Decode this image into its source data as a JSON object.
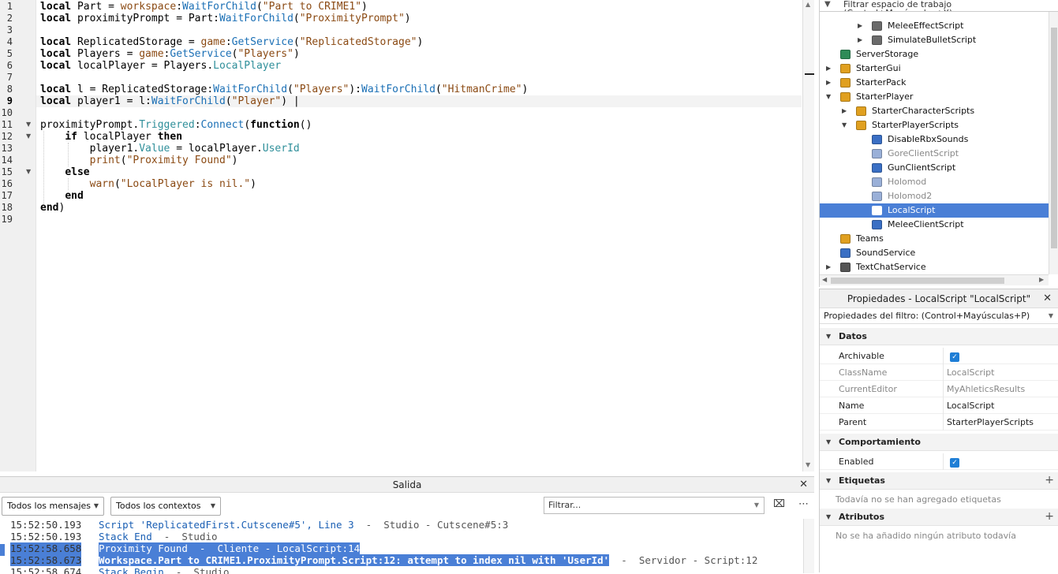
{
  "editor": {
    "line_numbers": [
      "1",
      "2",
      "3",
      "4",
      "5",
      "6",
      "7",
      "8",
      "9",
      "10",
      "11",
      "12",
      "13",
      "14",
      "15",
      "16",
      "17",
      "18",
      "19"
    ],
    "current_line": "9",
    "lines": [
      [
        {
          "c": "kw",
          "t": "local"
        },
        {
          "c": "",
          "t": " Part = "
        },
        {
          "c": "st",
          "t": "workspace"
        },
        {
          "c": "",
          "t": ":"
        },
        {
          "c": "fn",
          "t": "WaitForChild"
        },
        {
          "c": "",
          "t": "("
        },
        {
          "c": "st",
          "t": "\"Part to CRIME1\""
        },
        {
          "c": "",
          "t": ")"
        }
      ],
      [
        {
          "c": "kw",
          "t": "local"
        },
        {
          "c": "",
          "t": " proximityPrompt = Part:"
        },
        {
          "c": "fn",
          "t": "WaitForChild"
        },
        {
          "c": "",
          "t": "("
        },
        {
          "c": "st",
          "t": "\"ProximityPrompt\""
        },
        {
          "c": "",
          "t": ")"
        }
      ],
      [],
      [
        {
          "c": "kw",
          "t": "local"
        },
        {
          "c": "",
          "t": " ReplicatedStorage = "
        },
        {
          "c": "st",
          "t": "game"
        },
        {
          "c": "",
          "t": ":"
        },
        {
          "c": "fn",
          "t": "GetService"
        },
        {
          "c": "",
          "t": "("
        },
        {
          "c": "st",
          "t": "\"ReplicatedStorage\""
        },
        {
          "c": "",
          "t": ")"
        }
      ],
      [
        {
          "c": "kw",
          "t": "local"
        },
        {
          "c": "",
          "t": " Players = "
        },
        {
          "c": "st",
          "t": "game"
        },
        {
          "c": "",
          "t": ":"
        },
        {
          "c": "fn",
          "t": "GetService"
        },
        {
          "c": "",
          "t": "("
        },
        {
          "c": "st",
          "t": "\"Players\""
        },
        {
          "c": "",
          "t": ")"
        }
      ],
      [
        {
          "c": "kw",
          "t": "local"
        },
        {
          "c": "",
          "t": " localPlayer = Players."
        },
        {
          "c": "pr",
          "t": "LocalPlayer"
        }
      ],
      [],
      [
        {
          "c": "kw",
          "t": "local"
        },
        {
          "c": "",
          "t": " l = ReplicatedStorage:"
        },
        {
          "c": "fn",
          "t": "WaitForChild"
        },
        {
          "c": "",
          "t": "("
        },
        {
          "c": "st",
          "t": "\"Players\""
        },
        {
          "c": "",
          "t": "):"
        },
        {
          "c": "fn",
          "t": "WaitForChild"
        },
        {
          "c": "",
          "t": "("
        },
        {
          "c": "st",
          "t": "\"HitmanCrime\""
        },
        {
          "c": "",
          "t": ")"
        }
      ],
      [
        {
          "c": "kw",
          "t": "local"
        },
        {
          "c": "",
          "t": " player1 = l:"
        },
        {
          "c": "fn",
          "t": "WaitForChild"
        },
        {
          "c": "",
          "t": "("
        },
        {
          "c": "st",
          "t": "\"Player\""
        },
        {
          "c": "",
          "t": ") |"
        }
      ],
      [],
      [
        {
          "c": "",
          "t": "proximityPrompt."
        },
        {
          "c": "pr",
          "t": "Triggered"
        },
        {
          "c": "",
          "t": ":"
        },
        {
          "c": "fn",
          "t": "Connect"
        },
        {
          "c": "",
          "t": "("
        },
        {
          "c": "kw",
          "t": "function"
        },
        {
          "c": "",
          "t": "()"
        }
      ],
      [
        {
          "c": "",
          "t": "    "
        },
        {
          "c": "kw",
          "t": "if"
        },
        {
          "c": "",
          "t": " localPlayer "
        },
        {
          "c": "kw",
          "t": "then"
        }
      ],
      [
        {
          "c": "",
          "t": "        player1."
        },
        {
          "c": "pr",
          "t": "Value"
        },
        {
          "c": "",
          "t": " = localPlayer."
        },
        {
          "c": "pr",
          "t": "UserId"
        }
      ],
      [
        {
          "c": "",
          "t": "        "
        },
        {
          "c": "st",
          "t": "print"
        },
        {
          "c": "",
          "t": "("
        },
        {
          "c": "st",
          "t": "\"Proximity Found\""
        },
        {
          "c": "",
          "t": ")"
        }
      ],
      [
        {
          "c": "",
          "t": "    "
        },
        {
          "c": "kw",
          "t": "else"
        }
      ],
      [
        {
          "c": "",
          "t": "        "
        },
        {
          "c": "st",
          "t": "warn"
        },
        {
          "c": "",
          "t": "("
        },
        {
          "c": "st",
          "t": "\"LocalPlayer is nil.\""
        },
        {
          "c": "",
          "t": ")"
        }
      ],
      [
        {
          "c": "",
          "t": "    "
        },
        {
          "c": "kw",
          "t": "end"
        }
      ],
      [
        {
          "c": "kw",
          "t": "end"
        },
        {
          "c": "",
          "t": ")"
        }
      ],
      []
    ]
  },
  "explorer": {
    "filter_placeholder": "Filtrar espacio de trabajo (Control+Mayúsculas+X)",
    "items": [
      {
        "label": "MeleeEffectScript",
        "depth": 2,
        "twisty": "▶",
        "icon": "script-icon",
        "color": "#6b6b6b",
        "selected": false,
        "disabled": false
      },
      {
        "label": "SimulateBulletScript",
        "depth": 2,
        "twisty": "▶",
        "icon": "script-icon",
        "color": "#6b6b6b",
        "selected": false,
        "disabled": false
      },
      {
        "label": "ServerStorage",
        "depth": 0,
        "twisty": "",
        "icon": "server-storage-icon",
        "color": "#2e8b57",
        "selected": false,
        "disabled": false
      },
      {
        "label": "StarterGui",
        "depth": 0,
        "twisty": "▶",
        "icon": "folder-icon",
        "color": "#e0a020",
        "selected": false,
        "disabled": false
      },
      {
        "label": "StarterPack",
        "depth": 0,
        "twisty": "▶",
        "icon": "folder-icon",
        "color": "#e0a020",
        "selected": false,
        "disabled": false
      },
      {
        "label": "StarterPlayer",
        "depth": 0,
        "twisty": "▼",
        "icon": "folder-icon",
        "color": "#e0a020",
        "selected": false,
        "disabled": false
      },
      {
        "label": "StarterCharacterScripts",
        "depth": 1,
        "twisty": "▶",
        "icon": "folder-script-icon",
        "color": "#e0a020",
        "selected": false,
        "disabled": false
      },
      {
        "label": "StarterPlayerScripts",
        "depth": 1,
        "twisty": "▼",
        "icon": "folder-script-icon",
        "color": "#e0a020",
        "selected": false,
        "disabled": false
      },
      {
        "label": "DisableRbxSounds",
        "depth": 2,
        "twisty": "",
        "icon": "local-script-icon",
        "color": "#3a6fc4",
        "selected": false,
        "disabled": false
      },
      {
        "label": "GoreClientScript",
        "depth": 2,
        "twisty": "",
        "icon": "local-script-icon",
        "color": "#9ab0d8",
        "selected": false,
        "disabled": true
      },
      {
        "label": "GunClientScript",
        "depth": 2,
        "twisty": "",
        "icon": "local-script-icon",
        "color": "#3a6fc4",
        "selected": false,
        "disabled": false
      },
      {
        "label": "Holomod",
        "depth": 2,
        "twisty": "",
        "icon": "local-script-icon",
        "color": "#9ab0d8",
        "selected": false,
        "disabled": true
      },
      {
        "label": "Holomod2",
        "depth": 2,
        "twisty": "",
        "icon": "local-script-icon",
        "color": "#9ab0d8",
        "selected": false,
        "disabled": true
      },
      {
        "label": "LocalScript",
        "depth": 2,
        "twisty": "",
        "icon": "local-script-icon",
        "color": "#ffffff",
        "selected": true,
        "disabled": false
      },
      {
        "label": "MeleeClientScript",
        "depth": 2,
        "twisty": "",
        "icon": "local-script-icon",
        "color": "#3a6fc4",
        "selected": false,
        "disabled": false
      },
      {
        "label": "Teams",
        "depth": 0,
        "twisty": "",
        "icon": "teams-icon",
        "color": "#e0a020",
        "selected": false,
        "disabled": false
      },
      {
        "label": "SoundService",
        "depth": 0,
        "twisty": "",
        "icon": "sound-service-icon",
        "color": "#3a6fc4",
        "selected": false,
        "disabled": false
      },
      {
        "label": "TextChatService",
        "depth": 0,
        "twisty": "▶",
        "icon": "text-chat-icon",
        "color": "#555555",
        "selected": false,
        "disabled": false
      }
    ]
  },
  "properties": {
    "title": "Propiedades - LocalScript \"LocalScript\"",
    "filter": "Propiedades del filtro: (Control+Mayúsculas+P)",
    "sections": {
      "datos": "Datos",
      "comportamiento": "Comportamiento",
      "etiquetas": "Etiquetas",
      "atributos": "Atributos"
    },
    "rows": {
      "archivable": {
        "key": "Archivable",
        "checked": true
      },
      "classname": {
        "key": "ClassName",
        "value": "LocalScript"
      },
      "currenteditor": {
        "key": "CurrentEditor",
        "value": "MyAhleticsResults"
      },
      "name": {
        "key": "Name",
        "value": "LocalScript"
      },
      "parent": {
        "key": "Parent",
        "value": "StarterPlayerScripts"
      },
      "enabled": {
        "key": "Enabled",
        "checked": true
      }
    },
    "no_tags": "Todavía no se han agregado etiquetas",
    "no_attributes": "No se ha añadido ningún atributo todavía"
  },
  "output": {
    "title": "Salida",
    "messages_filter": "Todos los mensajes",
    "contexts_filter": "Todos los contextos",
    "filter_placeholder": "Filtrar...",
    "lines": [
      {
        "time": "15:52:50.193",
        "msg": "Script 'ReplicatedFirst.Cutscene#5', Line 3",
        "src": "  -  Studio - Cutscene#5:3",
        "kind": "blue",
        "hl": false
      },
      {
        "time": "15:52:50.193",
        "msg": "Stack End",
        "src": "  -  Studio",
        "kind": "blue",
        "hl": false
      },
      {
        "time": "15:52:58.658",
        "msg": "Proximity Found  -  Cliente - LocalScript:14",
        "src": "",
        "kind": "plain",
        "hl": true
      },
      {
        "time": "15:52:58.673",
        "msg": "Workspace.Part to CRIME1.ProximityPrompt.Script:12: attempt to index nil with 'UserId'",
        "src": "  -  Servidor - Script:12",
        "kind": "red",
        "hl": true
      },
      {
        "time": "15:52:58.674",
        "msg": "Stack Begin",
        "src": "  -  Studio",
        "kind": "blue",
        "hl": false
      }
    ]
  },
  "colors": {
    "accent": "#4a7fd6",
    "keyword": "#000000",
    "string": "#8b4a13",
    "method": "#1a6fb5",
    "error": "#c01c28"
  }
}
